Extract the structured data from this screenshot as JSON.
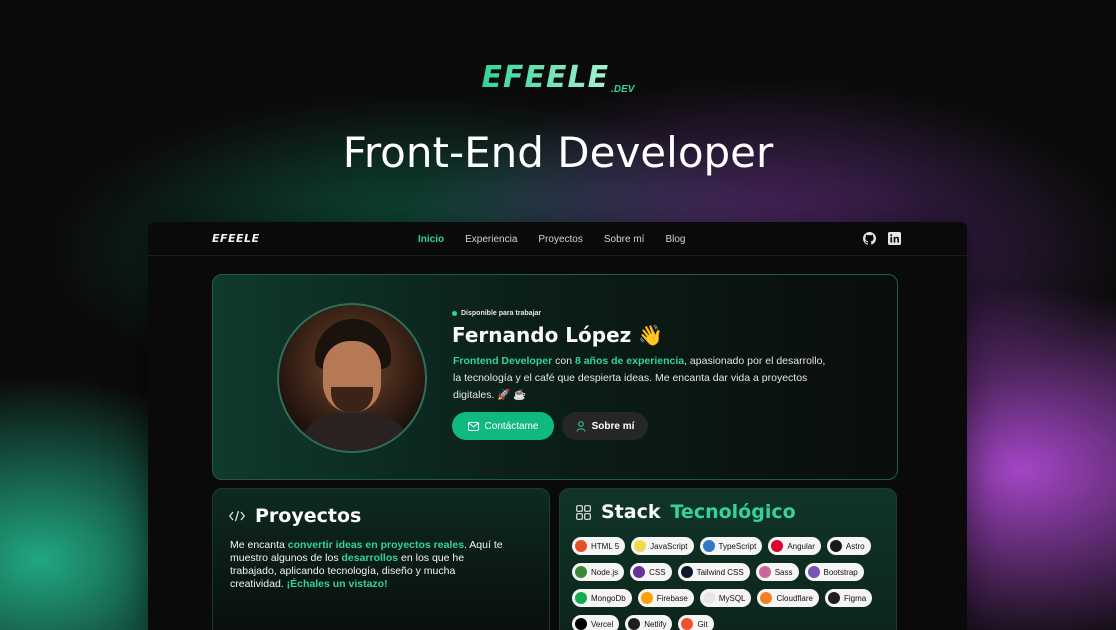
{
  "hero": {
    "logo_main": "EFEELE",
    "logo_suffix": ".DEV",
    "title": "Front-End Developer"
  },
  "nav": {
    "logo": "EFEELE",
    "links": [
      "Inicio",
      "Experiencia",
      "Proyectos",
      "Sobre mí",
      "Blog"
    ],
    "active": "Inicio",
    "icons": [
      "github-icon",
      "linkedin-icon"
    ]
  },
  "profile": {
    "status": "Disponible para trabajar",
    "name": "Fernando López 👋",
    "bio": {
      "role": "Frontend Developer",
      "con": " con ",
      "years": "8 años de experiencia",
      "rest": ", apasionado por el desarrollo, la tecnología y el café que despierta ideas. Me encanta dar vida a proyectos digitales. 🚀 ☕"
    },
    "contact_label": "Contáctame",
    "about_label": "Sobre mí"
  },
  "projects": {
    "title": "Proyectos",
    "text_1": "Me encanta ",
    "hl_1": "convertir ideas en proyectos reales",
    "text_2": ". Aquí te muestro algunos de los ",
    "hl_2": "desarrollos",
    "text_3": " en los que he trabajado, aplicando tecnología, diseño y mucha creatividad. ",
    "hl_3": "¡Échales un vistazo!"
  },
  "stack": {
    "title_main": "Stack",
    "title_accent": "Tecnológico",
    "items": [
      {
        "label": "HTML 5",
        "color": "#e34f26"
      },
      {
        "label": "JavaScript",
        "color": "#f0db4f"
      },
      {
        "label": "TypeScript",
        "color": "#3178c6"
      },
      {
        "label": "Angular",
        "color": "#dd0031"
      },
      {
        "label": "Astro",
        "color": "#17191e"
      },
      {
        "label": "Node.js",
        "color": "#3c873a"
      },
      {
        "label": "CSS",
        "color": "#663399"
      },
      {
        "label": "Tailwind CSS",
        "color": "#0f172a"
      },
      {
        "label": "Sass",
        "color": "#cc6699"
      },
      {
        "label": "Bootstrap",
        "color": "#7952b3"
      },
      {
        "label": "MongoDb",
        "color": "#13aa52"
      },
      {
        "label": "Firebase",
        "color": "#ffa000"
      },
      {
        "label": "MySQL",
        "color": "#e6e6e6"
      },
      {
        "label": "Cloudflare",
        "color": "#f38020"
      },
      {
        "label": "Figma",
        "color": "#1e1e1e"
      },
      {
        "label": "Vercel",
        "color": "#000000"
      },
      {
        "label": "Netlify",
        "color": "#1e1e1e"
      },
      {
        "label": "Git",
        "color": "#f05032"
      }
    ]
  }
}
